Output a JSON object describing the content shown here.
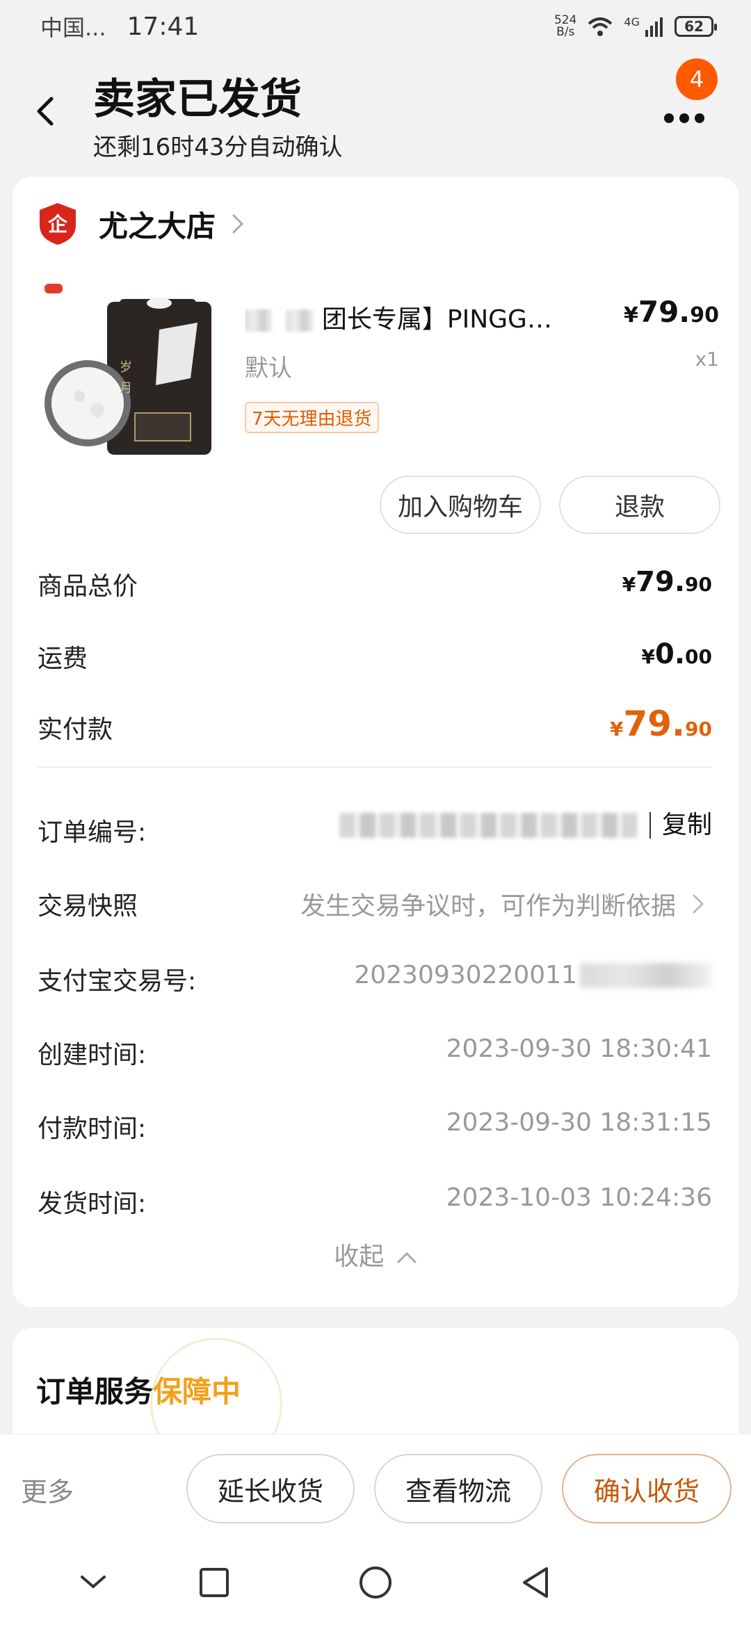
{
  "status_bar": {
    "carrier": "中国...",
    "time": "17:41",
    "net_speed_value": "524",
    "net_speed_unit": "B/s",
    "network_type": "4G",
    "battery": "62"
  },
  "header": {
    "title": "卖家已发货",
    "subtitle": "还剩16时43分自动确认",
    "more_badge": "4"
  },
  "shop": {
    "name": "尤之大店"
  },
  "product": {
    "title_suffix": "团长专属】PINGG…",
    "spec": "默认",
    "return_tag": "7天无理由退货",
    "price_symbol": "¥",
    "price_int": "79.",
    "price_dec": "90",
    "quantity": "x1",
    "buttons": {
      "add_to_cart": "加入购物车",
      "refund": "退款"
    }
  },
  "summary": {
    "goods_total_label": "商品总价",
    "goods_total_int": "79.",
    "goods_total_dec": "90",
    "shipping_label": "运费",
    "shipping_int": "0.",
    "shipping_dec": "00",
    "paid_label": "实付款",
    "paid_int": "79.",
    "paid_dec": "90",
    "currency": "¥"
  },
  "order_info": {
    "order_no_label": "订单编号:",
    "copy_label": "复制",
    "snapshot_label": "交易快照",
    "snapshot_hint": "发生交易争议时，可作为判断依据",
    "alipay_label": "支付宝交易号:",
    "alipay_no_visible": "20230930220011",
    "created_label": "创建时间:",
    "created_value": "2023-09-30 18:30:41",
    "paid_time_label": "付款时间:",
    "paid_time_value": "2023-09-30 18:31:15",
    "shipped_label": "发货时间:",
    "shipped_value": "2023-10-03 10:24:36",
    "collapse_label": "收起"
  },
  "service": {
    "title_prefix": "订单服务",
    "title_highlight": "保障中"
  },
  "action_bar": {
    "more": "更多",
    "extend": "延长收货",
    "logistics": "查看物流",
    "confirm": "确认收货"
  },
  "colors": {
    "accent_orange": "#e0620a",
    "badge_orange": "#ff5a00",
    "guarantee_yellow": "#f2a11a",
    "shop_red": "#d8261c"
  }
}
